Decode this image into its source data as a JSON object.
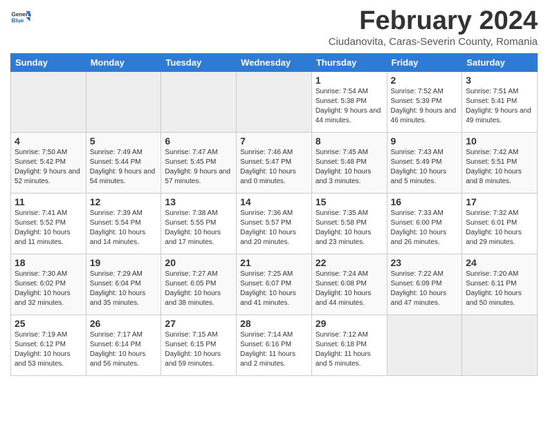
{
  "header": {
    "logo_general": "General",
    "logo_blue": "Blue",
    "title": "February 2024",
    "subtitle": "Ciudanovita, Caras-Severin County, Romania"
  },
  "weekdays": [
    "Sunday",
    "Monday",
    "Tuesday",
    "Wednesday",
    "Thursday",
    "Friday",
    "Saturday"
  ],
  "weeks": [
    [
      {
        "day": "",
        "sunrise": "",
        "sunset": "",
        "daylight": "",
        "empty": true
      },
      {
        "day": "",
        "sunrise": "",
        "sunset": "",
        "daylight": "",
        "empty": true
      },
      {
        "day": "",
        "sunrise": "",
        "sunset": "",
        "daylight": "",
        "empty": true
      },
      {
        "day": "",
        "sunrise": "",
        "sunset": "",
        "daylight": "",
        "empty": true
      },
      {
        "day": "1",
        "sunrise": "Sunrise: 7:54 AM",
        "sunset": "Sunset: 5:38 PM",
        "daylight": "Daylight: 9 hours and 44 minutes.",
        "empty": false
      },
      {
        "day": "2",
        "sunrise": "Sunrise: 7:52 AM",
        "sunset": "Sunset: 5:39 PM",
        "daylight": "Daylight: 9 hours and 46 minutes.",
        "empty": false
      },
      {
        "day": "3",
        "sunrise": "Sunrise: 7:51 AM",
        "sunset": "Sunset: 5:41 PM",
        "daylight": "Daylight: 9 hours and 49 minutes.",
        "empty": false
      }
    ],
    [
      {
        "day": "4",
        "sunrise": "Sunrise: 7:50 AM",
        "sunset": "Sunset: 5:42 PM",
        "daylight": "Daylight: 9 hours and 52 minutes.",
        "empty": false
      },
      {
        "day": "5",
        "sunrise": "Sunrise: 7:49 AM",
        "sunset": "Sunset: 5:44 PM",
        "daylight": "Daylight: 9 hours and 54 minutes.",
        "empty": false
      },
      {
        "day": "6",
        "sunrise": "Sunrise: 7:47 AM",
        "sunset": "Sunset: 5:45 PM",
        "daylight": "Daylight: 9 hours and 57 minutes.",
        "empty": false
      },
      {
        "day": "7",
        "sunrise": "Sunrise: 7:46 AM",
        "sunset": "Sunset: 5:47 PM",
        "daylight": "Daylight: 10 hours and 0 minutes.",
        "empty": false
      },
      {
        "day": "8",
        "sunrise": "Sunrise: 7:45 AM",
        "sunset": "Sunset: 5:48 PM",
        "daylight": "Daylight: 10 hours and 3 minutes.",
        "empty": false
      },
      {
        "day": "9",
        "sunrise": "Sunrise: 7:43 AM",
        "sunset": "Sunset: 5:49 PM",
        "daylight": "Daylight: 10 hours and 5 minutes.",
        "empty": false
      },
      {
        "day": "10",
        "sunrise": "Sunrise: 7:42 AM",
        "sunset": "Sunset: 5:51 PM",
        "daylight": "Daylight: 10 hours and 8 minutes.",
        "empty": false
      }
    ],
    [
      {
        "day": "11",
        "sunrise": "Sunrise: 7:41 AM",
        "sunset": "Sunset: 5:52 PM",
        "daylight": "Daylight: 10 hours and 11 minutes.",
        "empty": false
      },
      {
        "day": "12",
        "sunrise": "Sunrise: 7:39 AM",
        "sunset": "Sunset: 5:54 PM",
        "daylight": "Daylight: 10 hours and 14 minutes.",
        "empty": false
      },
      {
        "day": "13",
        "sunrise": "Sunrise: 7:38 AM",
        "sunset": "Sunset: 5:55 PM",
        "daylight": "Daylight: 10 hours and 17 minutes.",
        "empty": false
      },
      {
        "day": "14",
        "sunrise": "Sunrise: 7:36 AM",
        "sunset": "Sunset: 5:57 PM",
        "daylight": "Daylight: 10 hours and 20 minutes.",
        "empty": false
      },
      {
        "day": "15",
        "sunrise": "Sunrise: 7:35 AM",
        "sunset": "Sunset: 5:58 PM",
        "daylight": "Daylight: 10 hours and 23 minutes.",
        "empty": false
      },
      {
        "day": "16",
        "sunrise": "Sunrise: 7:33 AM",
        "sunset": "Sunset: 6:00 PM",
        "daylight": "Daylight: 10 hours and 26 minutes.",
        "empty": false
      },
      {
        "day": "17",
        "sunrise": "Sunrise: 7:32 AM",
        "sunset": "Sunset: 6:01 PM",
        "daylight": "Daylight: 10 hours and 29 minutes.",
        "empty": false
      }
    ],
    [
      {
        "day": "18",
        "sunrise": "Sunrise: 7:30 AM",
        "sunset": "Sunset: 6:02 PM",
        "daylight": "Daylight: 10 hours and 32 minutes.",
        "empty": false
      },
      {
        "day": "19",
        "sunrise": "Sunrise: 7:29 AM",
        "sunset": "Sunset: 6:04 PM",
        "daylight": "Daylight: 10 hours and 35 minutes.",
        "empty": false
      },
      {
        "day": "20",
        "sunrise": "Sunrise: 7:27 AM",
        "sunset": "Sunset: 6:05 PM",
        "daylight": "Daylight: 10 hours and 38 minutes.",
        "empty": false
      },
      {
        "day": "21",
        "sunrise": "Sunrise: 7:25 AM",
        "sunset": "Sunset: 6:07 PM",
        "daylight": "Daylight: 10 hours and 41 minutes.",
        "empty": false
      },
      {
        "day": "22",
        "sunrise": "Sunrise: 7:24 AM",
        "sunset": "Sunset: 6:08 PM",
        "daylight": "Daylight: 10 hours and 44 minutes.",
        "empty": false
      },
      {
        "day": "23",
        "sunrise": "Sunrise: 7:22 AM",
        "sunset": "Sunset: 6:09 PM",
        "daylight": "Daylight: 10 hours and 47 minutes.",
        "empty": false
      },
      {
        "day": "24",
        "sunrise": "Sunrise: 7:20 AM",
        "sunset": "Sunset: 6:11 PM",
        "daylight": "Daylight: 10 hours and 50 minutes.",
        "empty": false
      }
    ],
    [
      {
        "day": "25",
        "sunrise": "Sunrise: 7:19 AM",
        "sunset": "Sunset: 6:12 PM",
        "daylight": "Daylight: 10 hours and 53 minutes.",
        "empty": false
      },
      {
        "day": "26",
        "sunrise": "Sunrise: 7:17 AM",
        "sunset": "Sunset: 6:14 PM",
        "daylight": "Daylight: 10 hours and 56 minutes.",
        "empty": false
      },
      {
        "day": "27",
        "sunrise": "Sunrise: 7:15 AM",
        "sunset": "Sunset: 6:15 PM",
        "daylight": "Daylight: 10 hours and 59 minutes.",
        "empty": false
      },
      {
        "day": "28",
        "sunrise": "Sunrise: 7:14 AM",
        "sunset": "Sunset: 6:16 PM",
        "daylight": "Daylight: 11 hours and 2 minutes.",
        "empty": false
      },
      {
        "day": "29",
        "sunrise": "Sunrise: 7:12 AM",
        "sunset": "Sunset: 6:18 PM",
        "daylight": "Daylight: 11 hours and 5 minutes.",
        "empty": false
      },
      {
        "day": "",
        "sunrise": "",
        "sunset": "",
        "daylight": "",
        "empty": true
      },
      {
        "day": "",
        "sunrise": "",
        "sunset": "",
        "daylight": "",
        "empty": true
      }
    ]
  ]
}
